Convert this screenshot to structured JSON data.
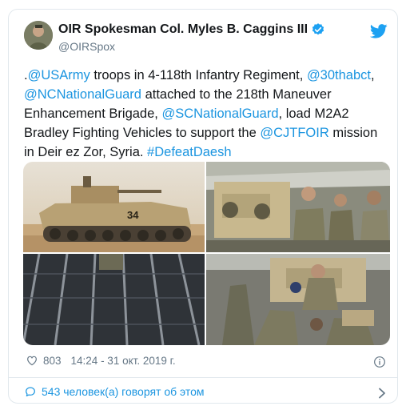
{
  "author": {
    "name": "OIR Spokesman Col. Myles B. Caggins III",
    "handle": "@OIRSpox"
  },
  "tweet": {
    "seg0": ".",
    "seg1": "@USArmy",
    "seg2": " troops in 4-118th Infantry Regiment, ",
    "seg3": "@30thabct",
    "seg4": ", ",
    "seg5": "@NCNationalGuard",
    "seg6": " attached to the 218th Maneuver Enhancement Brigade, ",
    "seg7": "@SCNationalGuard",
    "seg8": ", load M2A2 Bradley Fighting Vehicles to support the ",
    "seg9": "@CJTFOIR",
    "seg10": " mission in Deir ez Zor, Syria. ",
    "seg11": "#DefeatDaesh"
  },
  "vehicle_number": "34",
  "stats": {
    "likes": "803",
    "timestamp": "14:24 - 31 окт. 2019 г."
  },
  "footer": {
    "talking": "543 человек(а) говорят об этом"
  },
  "colors": {
    "link": "#1b95e0",
    "muted": "#657786",
    "border": "#e1e8ed"
  },
  "icons": [
    "verified-icon",
    "twitter-bird-icon",
    "heart-icon",
    "info-icon",
    "reply-bubble-icon",
    "chevron-right-icon"
  ]
}
